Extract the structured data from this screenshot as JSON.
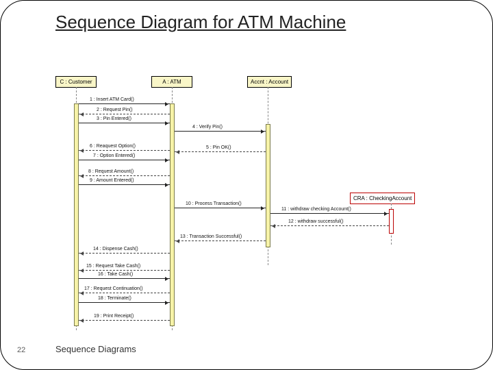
{
  "title": "Sequence Diagram for ATM Machine",
  "footer": {
    "page": "22",
    "label": "Sequence Diagrams"
  },
  "actors": {
    "customer": "C : Customer",
    "atm": "A : ATM",
    "account": "Accnt : Account",
    "checking": "CRA : CheckingAccount"
  },
  "messages": {
    "m1": "1 : Insert ATM Card()",
    "m2": "2 : Request Pin()",
    "m3": "3 : Pin Entered()",
    "m4": "4 : Verify Pin()",
    "m5": "5 : Pin OK()",
    "m6": "6 : Reaquest Option()",
    "m7": "7 : Option Entered()",
    "m8": "8 : Request Amount()",
    "m9": "9 : Amount Entered()",
    "m10": "10 : Process Transaction()",
    "m11": "11 : withdraw checking Account()",
    "m12": "12 : withdraw successful()",
    "m13": "13 : Transaction Successful()",
    "m14": "14 : Dispense Cash()",
    "m15": "15 : Request Take Cash()",
    "m16": "16 : Take Cash()",
    "m17": "17 : Request Continuation()",
    "m18": "18 : Terminate()",
    "m19": "19 : Print Receipt()"
  },
  "chart_data": {
    "type": "area",
    "title": "Sequence Diagram for ATM Machine",
    "xlabel": "",
    "ylabel": "",
    "participants": [
      "C : Customer",
      "A : ATM",
      "Accnt : Account",
      "CRA : CheckingAccount"
    ],
    "interactions": [
      {
        "from": "Customer",
        "to": "ATM",
        "label": "1 : Insert ATM Card()",
        "ret": false
      },
      {
        "from": "ATM",
        "to": "Customer",
        "label": "2 : Request Pin()",
        "ret": true
      },
      {
        "from": "Customer",
        "to": "ATM",
        "label": "3 : Pin Entered()",
        "ret": false
      },
      {
        "from": "ATM",
        "to": "Account",
        "label": "4 : Verify Pin()",
        "ret": false
      },
      {
        "from": "Account",
        "to": "ATM",
        "label": "5 : Pin OK()",
        "ret": true
      },
      {
        "from": "ATM",
        "to": "Customer",
        "label": "6 : Reaquest Option()",
        "ret": true
      },
      {
        "from": "Customer",
        "to": "ATM",
        "label": "7 : Option Entered()",
        "ret": false
      },
      {
        "from": "ATM",
        "to": "Customer",
        "label": "8 : Request Amount()",
        "ret": true
      },
      {
        "from": "Customer",
        "to": "ATM",
        "label": "9 : Amount Entered()",
        "ret": false
      },
      {
        "from": "ATM",
        "to": "Account",
        "label": "10 : Process Transaction()",
        "ret": false
      },
      {
        "from": "Account",
        "to": "CheckingAccount",
        "label": "11 : withdraw checking Account()",
        "ret": false
      },
      {
        "from": "CheckingAccount",
        "to": "Account",
        "label": "12 : withdraw successful()",
        "ret": true
      },
      {
        "from": "Account",
        "to": "ATM",
        "label": "13 : Transaction Successful()",
        "ret": true
      },
      {
        "from": "ATM",
        "to": "Customer",
        "label": "14 : Dispense Cash()",
        "ret": true
      },
      {
        "from": "ATM",
        "to": "Customer",
        "label": "15 : Request Take Cash()",
        "ret": true
      },
      {
        "from": "Customer",
        "to": "ATM",
        "label": "16 : Take Cash()",
        "ret": false
      },
      {
        "from": "ATM",
        "to": "Customer",
        "label": "17 : Request Continuation()",
        "ret": true
      },
      {
        "from": "Customer",
        "to": "ATM",
        "label": "18 : Terminate()",
        "ret": false
      },
      {
        "from": "ATM",
        "to": "Customer",
        "label": "19 : Print Receipt()",
        "ret": true
      }
    ]
  }
}
